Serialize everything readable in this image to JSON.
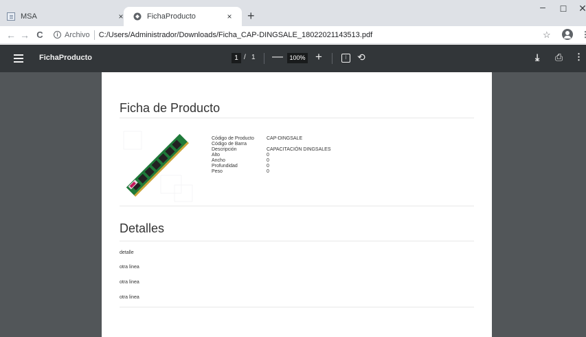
{
  "browser": {
    "tabs": [
      {
        "title": "MSA",
        "close": "×"
      },
      {
        "title": "FichaProducto",
        "close": "×"
      }
    ],
    "new_tab": "+",
    "window_controls": {
      "minimize": "–",
      "maximize": "☐",
      "close": "✕"
    },
    "address": {
      "back": "←",
      "forward": "→",
      "reload": "C",
      "security_label": "Archivo",
      "url": "C:/Users/Administrador/Downloads/Ficha_CAP-DINGSALE_18022021143513.pdf"
    }
  },
  "pdf_toolbar": {
    "title": "FichaProducto",
    "current_page": "1",
    "page_separator": "/",
    "total_pages": "1",
    "zoom_out": "—",
    "zoom": "100%",
    "zoom_in": "+"
  },
  "document": {
    "heading": "Ficha de Producto",
    "specs": [
      {
        "label": "Código de Producto",
        "value": "CAP-DINGSALE"
      },
      {
        "label": "Código de Barra",
        "value": ""
      },
      {
        "label": "Descripción",
        "value": "CAPACITACIÓN DINGSALES"
      },
      {
        "label": "Alto",
        "value": "0"
      },
      {
        "label": "Ancho",
        "value": "0"
      },
      {
        "label": "Profundidad",
        "value": "0"
      },
      {
        "label": "Peso",
        "value": "0"
      }
    ],
    "details_heading": "Detalles",
    "details": [
      "detalle",
      "otra linea",
      "otra linea",
      "otra linea"
    ]
  },
  "colors": {
    "tabstrip": "#dee1e6",
    "pdf_toolbar": "#323639",
    "viewer_background": "#525659",
    "ram_board": "#1f7a3a"
  }
}
